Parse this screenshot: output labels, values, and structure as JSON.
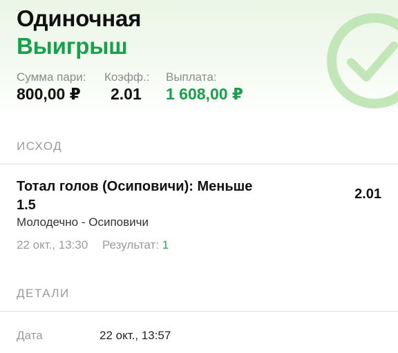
{
  "colors": {
    "accent_green": "#19a04b",
    "badge_green": "#bfe3b4",
    "label_gray": "#8c8c8c"
  },
  "bet": {
    "type": "Одиночная",
    "status": "Выигрыш",
    "status_icon": "checkmark-circle-icon",
    "stake_label": "Сумма пари:",
    "stake_value": "800,00 ₽",
    "odds_label": "Коэфф.:",
    "odds_value": "2.01",
    "payout_label": "Выплата:",
    "payout_value": "1 608,00 ₽"
  },
  "outcome_section": {
    "title": "ИСХОД",
    "market": "Тотал голов (Осиповичи): Меньше 1.5",
    "odds": "2.01",
    "match": "Молодечно - Осиповичи",
    "datetime": "22 окт., 13:30",
    "result_label": "Результат:",
    "result_value": "1"
  },
  "details_section": {
    "title": "ДЕТАЛИ",
    "date_label": "Дата",
    "date_value": "22 окт., 13:57"
  }
}
